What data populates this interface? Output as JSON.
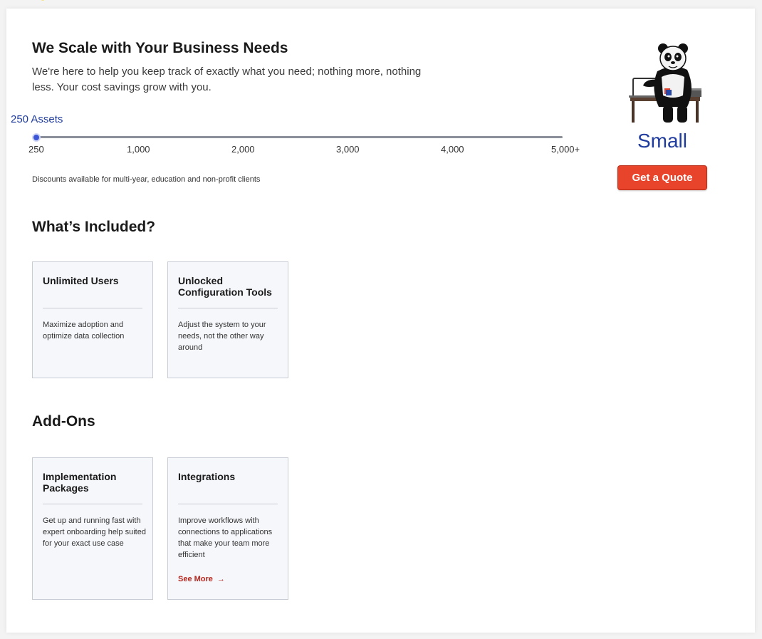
{
  "header": {
    "title": "We Scale with Your Business Needs",
    "subtitle": "We're here to help you keep track of exactly what you need; nothing more, nothing less. Your cost savings grow with you."
  },
  "slider": {
    "label": "250 Assets",
    "value": 250,
    "ticks": [
      "250",
      "1,000",
      "2,000",
      "3,000",
      "4,000",
      "5,000+"
    ]
  },
  "discount_note": "Discounts available for multi-year, education and non-profit clients",
  "plan": {
    "icon": "panda-at-desk-illustration",
    "name": "Small",
    "cta_label": "Get a Quote",
    "cta_color": "#e8432b",
    "name_color": "#1f3c9e"
  },
  "included": {
    "title": "What’s Included?",
    "items": [
      {
        "title": "Unlimited Users",
        "description": "Maximize adoption and optimize data collection"
      },
      {
        "title": "Unlocked Configuration Tools",
        "description": "Adjust the system to your needs, not the other way around"
      }
    ]
  },
  "addons": {
    "title": "Add-Ons",
    "items": [
      {
        "title": "Implementation Packages",
        "description": "Get up and running fast with expert onboarding help suited for your exact use case"
      },
      {
        "title": "Integrations",
        "description": "Improve workflows with connections to applications that make your team more efficient",
        "link_label": "See More",
        "link_icon": "arrow-right-icon"
      }
    ]
  }
}
